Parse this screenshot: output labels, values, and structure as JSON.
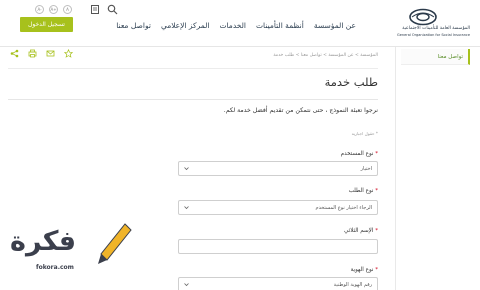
{
  "header": {
    "logo_ar": "المؤسسة العامة للتأمينات الاجتماعية",
    "logo_en": "General Organization for Social Insurance",
    "nav": [
      "عن المؤسسة",
      "أنظمة التأمينات",
      "الخدمات",
      "المركز الإعلامي",
      "تواصل معنا"
    ],
    "login_label": "تسجيل الدخول",
    "access_a": "A-",
    "access_b": "A+",
    "access_c": "A"
  },
  "sidebar": {
    "items": [
      {
        "label": "تواصل معنا"
      }
    ]
  },
  "main": {
    "breadcrumb": "المؤسسة > عن المؤسسة > تواصل معنا > طلب خدمة",
    "title": "طلب خدمة",
    "intro": "نرجوا تعبئة النموذج ، حتى نتمكن من تقديم أفضل خدمة لكم.",
    "required_note": "* حقول اجبارية",
    "fields": [
      {
        "label": "نوع المستخدم",
        "value": "اختيار",
        "type": "select"
      },
      {
        "label": "نوع الطلب",
        "value": "الرجاء اختيار نوع المستخدم",
        "type": "select"
      },
      {
        "label": "الإسم الثلاثي",
        "value": "",
        "type": "text"
      },
      {
        "label": "نوع الهوية",
        "value": "رقم الهوية الوطنية",
        "type": "select"
      }
    ]
  },
  "watermark": {
    "text": "فكرة",
    "sub": "fokora.com"
  },
  "colors": {
    "accent": "#a7c11c",
    "sidebar_text": "#5b8f2a",
    "required": "#d0021b"
  }
}
